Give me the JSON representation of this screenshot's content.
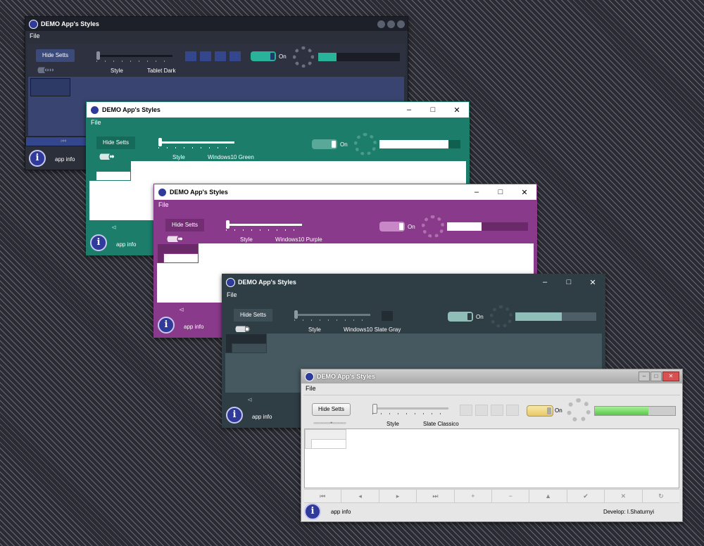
{
  "app": {
    "title": "DEMO App's Styles"
  },
  "menu": {
    "file": "File"
  },
  "common": {
    "hide_setts": "Hide Setts",
    "style_label": "Style",
    "toggle_on": "On",
    "app_info": "app info",
    "info_glyph": "i",
    "minimize": "–",
    "maximize": "□",
    "close": "✕"
  },
  "windows": [
    {
      "style_name": "Tablet Dark",
      "progress": 0.22,
      "accent": "#28b39a"
    },
    {
      "style_name": "Windows10 Green",
      "progress": 0.85,
      "accent": "#1b7d6a"
    },
    {
      "style_name": "Windows10 Purple",
      "progress": 0.43,
      "accent": "#8a3a8a"
    },
    {
      "style_name": "Windows10 Slate Gray",
      "progress": 0.57,
      "accent": "#2f3d44"
    },
    {
      "style_name": "Slate Classico",
      "progress": 0.67,
      "accent": "#66dd55"
    }
  ],
  "dots": {
    "w0": "(((((((((◖◗◗◗",
    "w1": "(((((((((((((◖●",
    "w2": "((((((((((((((◖●",
    "w3": "(((((((((((((◉",
    "w4": "◦◦◦◦◦◦◦◦◦◦◦•◦◦◦◦◦◦◦◦◦"
  },
  "nav_glyphs": {
    "first": "⏮",
    "prev": "◂",
    "next": "▸",
    "last": "⏭",
    "add": "+",
    "del": "−",
    "up": "▲",
    "ok": "✔",
    "cancel": "✕",
    "refresh": "↻",
    "first_outline": "⊲",
    "prev_outline": "◁"
  },
  "footer": {
    "developer": "Develop: I.Shaturnyi"
  },
  "icons": [
    "app-logo-icon",
    "info-icon",
    "minimize-icon",
    "maximize-icon",
    "close-icon"
  ]
}
